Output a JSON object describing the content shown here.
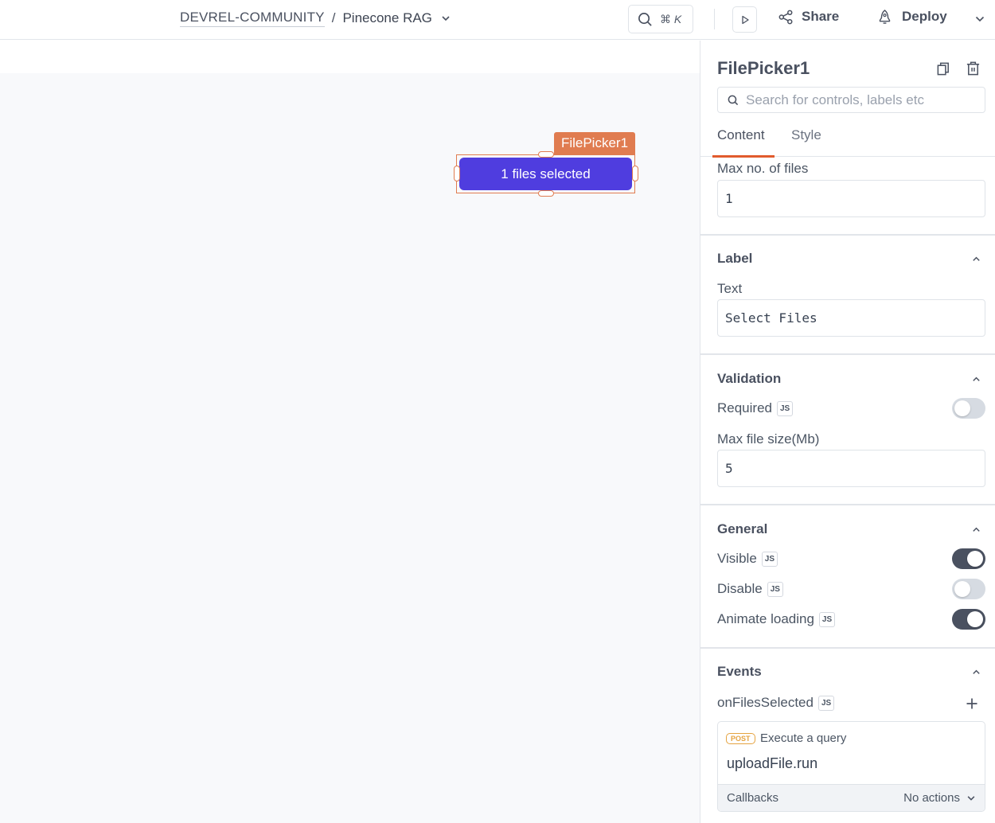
{
  "header": {
    "workspace": "DEVREL-COMMUNITY",
    "separator": "/",
    "app_name": "Pinecone RAG",
    "search_shortcut_symbol": "⌘",
    "search_shortcut_key": "K",
    "share_label": "Share",
    "deploy_label": "Deploy"
  },
  "canvas": {
    "widget_name": "FilePicker1",
    "widget_button_text": "1 files selected",
    "widget_button_color": "#4f3ddf",
    "selection_color": "#e07c50"
  },
  "pane": {
    "title": "FilePicker1",
    "search_placeholder": "Search for controls, labels etc",
    "tabs": [
      {
        "label": "Content",
        "active": true
      },
      {
        "label": "Style",
        "active": false
      }
    ],
    "max_files": {
      "label": "Max no. of files",
      "value": "1"
    },
    "sections": {
      "label": {
        "title": "Label",
        "text_label": "Text",
        "text_value": "Select Files"
      },
      "validation": {
        "title": "Validation",
        "required_label": "Required",
        "required_on": false,
        "max_size_label": "Max file size(Mb)",
        "max_size_value": "5"
      },
      "general": {
        "title": "General",
        "visible_label": "Visible",
        "visible_on": true,
        "disable_label": "Disable",
        "disable_on": false,
        "animate_label": "Animate loading",
        "animate_on": true
      },
      "events": {
        "title": "Events",
        "event_name": "onFilesSelected",
        "action": {
          "method_badge": "POST",
          "type": "Execute a query",
          "query": "uploadFile.run",
          "callbacks_label": "Callbacks",
          "callbacks_value": "No actions"
        }
      }
    },
    "js_badge": "JS"
  }
}
